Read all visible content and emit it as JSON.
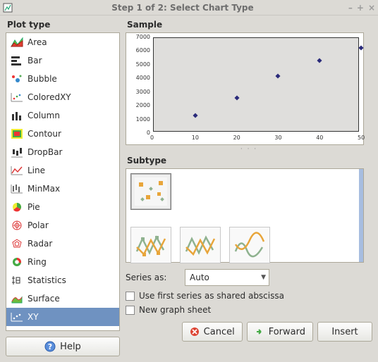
{
  "window": {
    "title": "Step 1 of 2: Select Chart Type"
  },
  "left": {
    "heading": "Plot type",
    "types": [
      {
        "label": "Area"
      },
      {
        "label": "Bar"
      },
      {
        "label": "Bubble"
      },
      {
        "label": "ColoredXY"
      },
      {
        "label": "Column"
      },
      {
        "label": "Contour"
      },
      {
        "label": "DropBar"
      },
      {
        "label": "Line"
      },
      {
        "label": "MinMax"
      },
      {
        "label": "Pie"
      },
      {
        "label": "Polar"
      },
      {
        "label": "Radar"
      },
      {
        "label": "Ring"
      },
      {
        "label": "Statistics"
      },
      {
        "label": "Surface"
      },
      {
        "label": "XY"
      }
    ],
    "selected_index": 15,
    "help_label": "Help"
  },
  "right": {
    "sample_heading": "Sample",
    "subtype_heading": "Subtype",
    "series_as_label": "Series as:",
    "series_as_value": "Auto",
    "cb_shared_abscissa": "Use first series as shared abscissa",
    "cb_new_sheet": "New graph sheet",
    "btn_cancel": "Cancel",
    "btn_forward": "Forward",
    "btn_insert": "Insert"
  },
  "chart_data": {
    "type": "scatter",
    "title": "",
    "xlabel": "",
    "ylabel": "",
    "xlim": [
      0,
      50
    ],
    "ylim": [
      0,
      7000
    ],
    "xticks": [
      0,
      10,
      20,
      30,
      40,
      50
    ],
    "yticks": [
      0,
      1000,
      2000,
      3000,
      4000,
      5000,
      6000,
      7000
    ],
    "series": [
      {
        "name": "",
        "x": [
          10,
          20,
          30,
          40,
          50
        ],
        "y": [
          1350,
          2600,
          4200,
          5350,
          6300
        ]
      }
    ]
  }
}
